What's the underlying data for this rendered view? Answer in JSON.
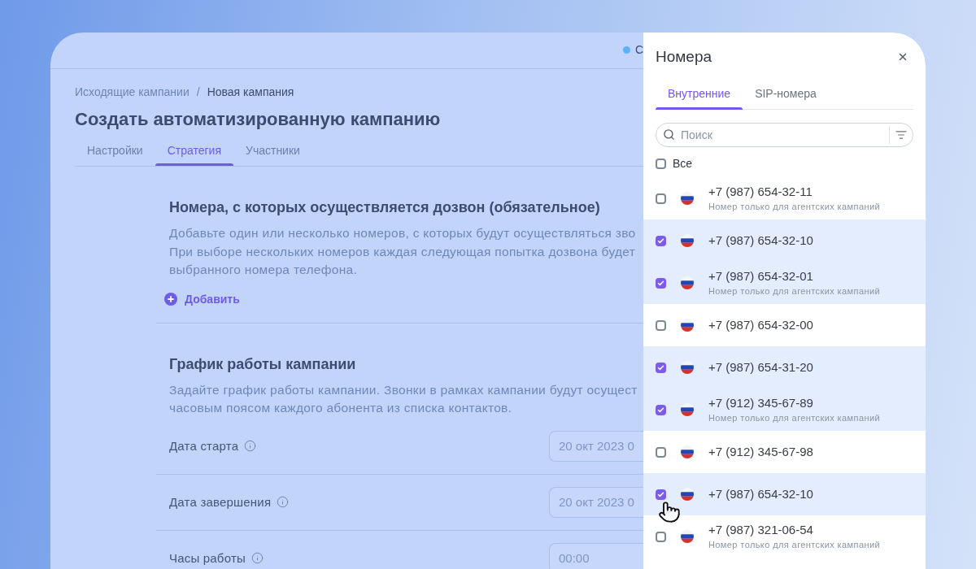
{
  "top_bar": {
    "status": {
      "label": "С"
    }
  },
  "breadcrumb": {
    "separator": "/",
    "items": [
      {
        "label": "Исходящие кампании",
        "current": false
      },
      {
        "label": "Новая кампания",
        "current": true
      }
    ]
  },
  "page_title": "Создать автоматизированную кампанию",
  "tabs": [
    {
      "label": "Настройки",
      "selected": false
    },
    {
      "label": "Стратегия",
      "selected": true
    },
    {
      "label": "Участники",
      "selected": false
    }
  ],
  "sections": [
    {
      "kind": "numbers",
      "heading": "Номера, с которых осуществляется дозвон (обязательное)",
      "description_lines": [
        "Добавьте один или несколько номеров, с которых будут осуществляться зво",
        "При выборе нескольких номеров каждая следующая попытка дозвона будет",
        "выбранного номера телефона."
      ],
      "add_button": {
        "label": "Добавить"
      }
    },
    {
      "kind": "schedule",
      "heading": "График работы кампании",
      "description_lines": [
        "Задайте график работы кампании. Звонки в рамках кампании будут осущест",
        "часовым поясом каждого абонента из списка контактов."
      ],
      "fields": [
        {
          "label": "Дата старта",
          "placeholder": "20 окт 2023 0"
        },
        {
          "label": "Дата завершения",
          "placeholder": "20 окт 2023 0"
        },
        {
          "label": "Часы работы",
          "placeholder": "00:00"
        }
      ]
    }
  ],
  "drawer": {
    "title": "Номера",
    "tabs": [
      {
        "label": "Внутренние",
        "selected": true
      },
      {
        "label": "SIP-номера",
        "selected": false
      }
    ],
    "search": {
      "placeholder": "Поиск"
    },
    "select_all": {
      "label": "Все",
      "checked": false
    },
    "numbers": [
      {
        "phone": "+7 (987) 654-32-11",
        "note": "Номер только для агентских кампаний",
        "checked": false
      },
      {
        "phone": "+7 (987) 654-32-10",
        "checked": true
      },
      {
        "phone": "+7 (987) 654-32-01",
        "note": "Номер только для агентских кампаний",
        "checked": true
      },
      {
        "phone": "+7 (987) 654-32-00",
        "checked": false
      },
      {
        "phone": "+7 (987) 654-31-20",
        "checked": true
      },
      {
        "phone": "+7 (912) 345-67-89",
        "note": "Номер только для агентских кампаний",
        "checked": true
      },
      {
        "phone": "+7 (912) 345-67-98",
        "checked": false
      },
      {
        "phone": "+7 (987) 654-32-10",
        "checked": true
      },
      {
        "phone": "+7 (987) 321-06-54",
        "note": "Номер только для агентских кампаний",
        "checked": false
      }
    ]
  }
}
